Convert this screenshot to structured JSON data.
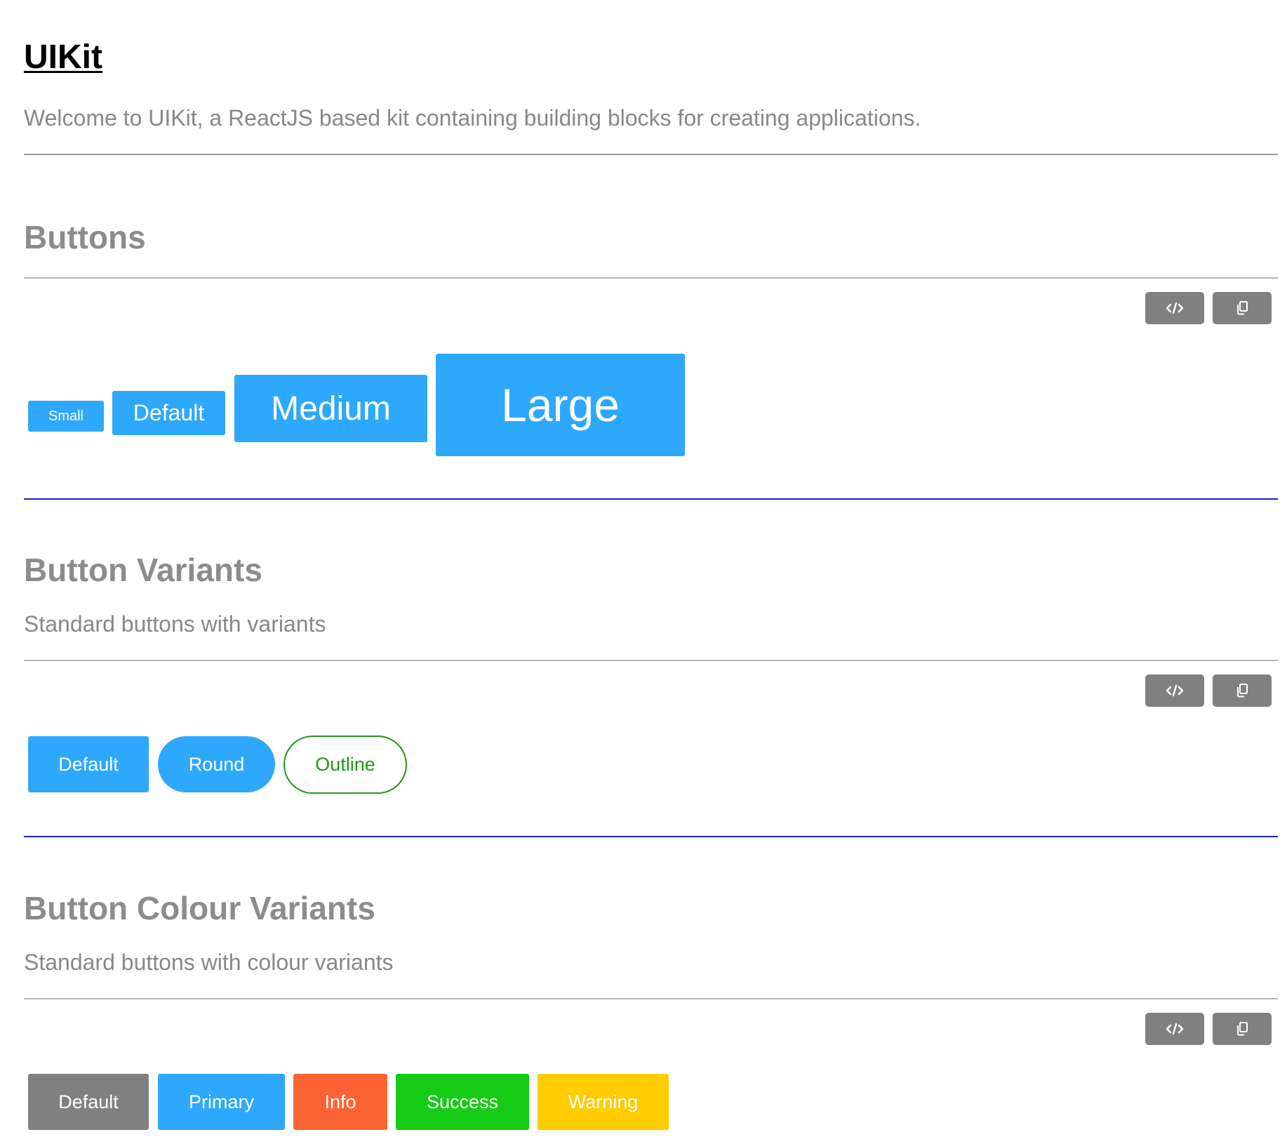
{
  "app": {
    "title": "UIKit",
    "subtitle": "Welcome to UIKit, a ReactJS based kit containing building blocks for creating applications."
  },
  "toolbar": {
    "code_icon": "code-icon",
    "copy_icon": "copy-icon",
    "button_color": "#808080"
  },
  "sections": {
    "buttons": {
      "title": "Buttons",
      "items": {
        "small": "Small",
        "default": "Default",
        "medium": "Medium",
        "large": "Large"
      }
    },
    "variants": {
      "title": "Button Variants",
      "description": "Standard buttons with variants",
      "items": {
        "default": "Default",
        "round": "Round",
        "outline": "Outline"
      }
    },
    "colours": {
      "title": "Button Colour Variants",
      "description": "Standard buttons with colour variants",
      "items": {
        "default": "Default",
        "primary": "Primary",
        "info": "Info",
        "success": "Success",
        "warning": "Warning"
      }
    }
  },
  "colors": {
    "primary": "#2ea8fc",
    "default": "#808080",
    "info": "#fa6434",
    "success": "#16cc16",
    "warning": "#ffcc00",
    "outline": "#1e9a12",
    "section_divider": "#1a22c8"
  }
}
